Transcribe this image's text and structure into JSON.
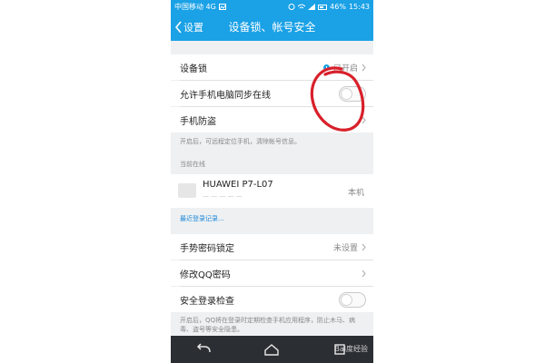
{
  "status_bar": {
    "carrier": "中国移动 4G",
    "battery_percent": "46%",
    "time": "15:43"
  },
  "nav": {
    "back_label": "设置",
    "title": "设备锁、帐号安全"
  },
  "settings": {
    "device_lock": {
      "label": "设备锁",
      "status": "已开启"
    },
    "sync_online": {
      "label": "允许手机电脑同步在线",
      "enabled": false
    },
    "anti_theft": {
      "label": "手机防盗",
      "note": "开启后，可远程定位手机，清除帐号信息。"
    },
    "current_online_header": "当前在线",
    "device": {
      "name": "HUAWEI P7-L07",
      "tag": "本机"
    },
    "recent_login_link": "最近登录记录...",
    "gesture_lock": {
      "label": "手势密码锁定",
      "status": "未设置"
    },
    "change_qq_password": {
      "label": "修改QQ密码"
    },
    "security_login_check": {
      "label": "安全登录检查",
      "enabled": false,
      "note": "开启后，QQ将在登录时定期检查手机应用程序，防止木马、病毒、盗号等安全隐患。"
    }
  },
  "watermark": "Bai度经验",
  "colors": {
    "accent": "#1aa1e6",
    "annotation": "#d8202a",
    "link": "#1a86d8"
  },
  "icons": [
    "chevron-left-icon",
    "chevron-right-icon",
    "info-icon",
    "back-icon",
    "home-icon",
    "recents-icon"
  ]
}
